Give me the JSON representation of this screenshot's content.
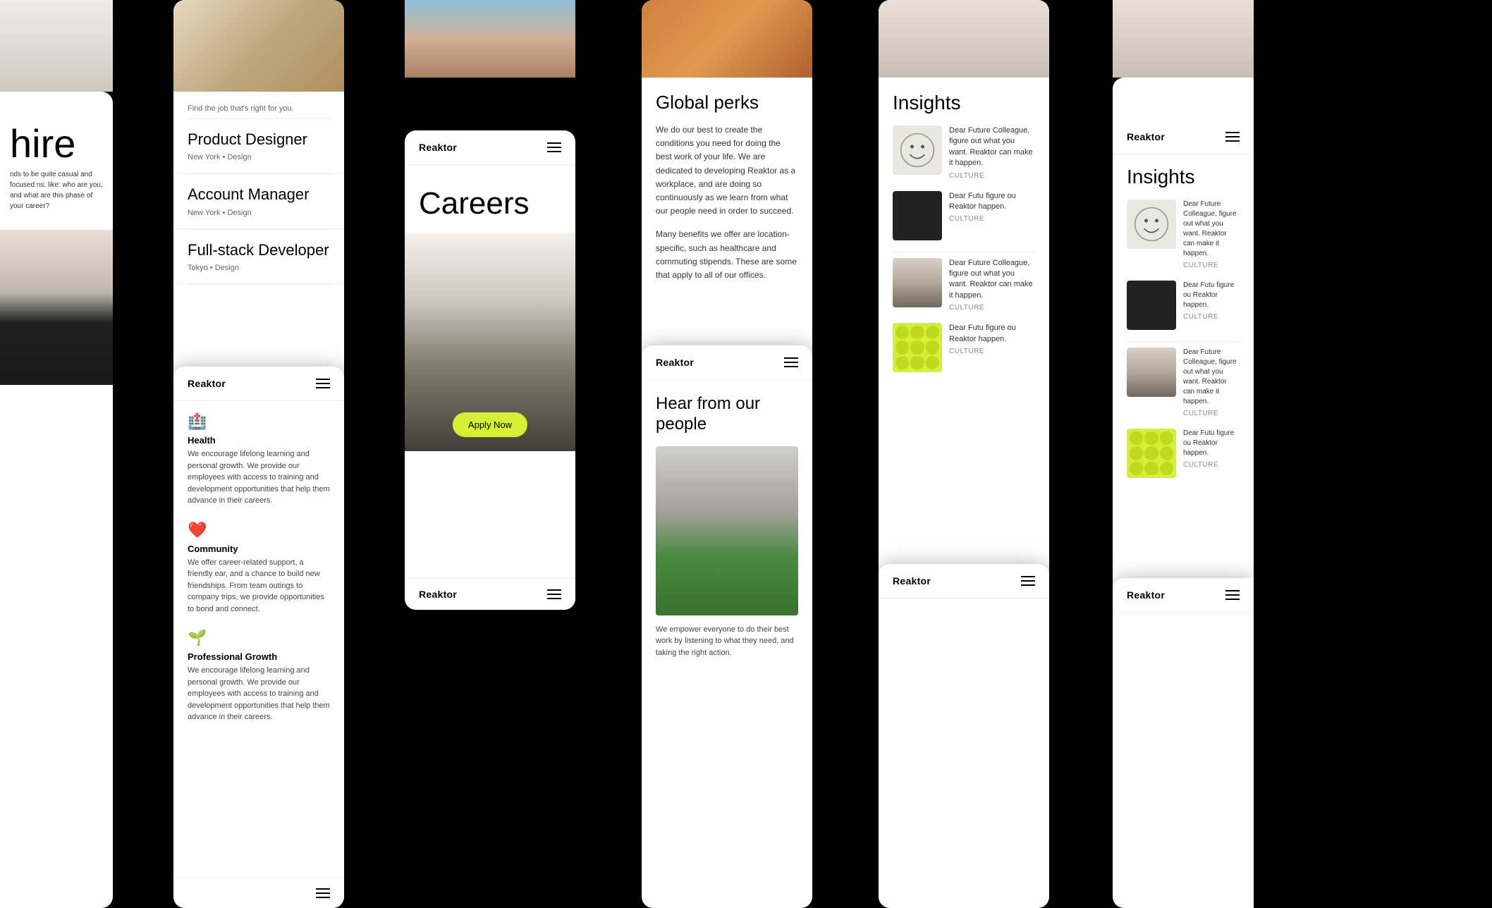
{
  "brand": {
    "logo": "Reaktor"
  },
  "cards": {
    "hire": {
      "heading": "hire",
      "subtext": "nds to be quite casual and focused ns, like: who are you, and what are this phase of your career?"
    },
    "jobs": {
      "subtitle": "Find the job that's right for you.",
      "list": [
        {
          "title": "Product Designer",
          "location": "New York",
          "department": "Design"
        },
        {
          "title": "Account Manager",
          "location": "New York",
          "department": "Design"
        },
        {
          "title": "Full-stack Developer",
          "location": "Tokyo",
          "department": "Design"
        }
      ]
    },
    "careers": {
      "title": "Careers",
      "apply_button": "Apply Now"
    },
    "perks": {
      "title": "Global perks",
      "text1": "We do our best to create the conditions you need for doing the best work of your life. We are dedicated to developing Reaktor as a workplace, and are doing so continuously as we learn from what our people need in order to succeed.",
      "text2": "Many benefits we offer are location-specific, such as healthcare and commuting stipends. These are some that apply to all of our offices."
    },
    "health": {
      "benefits": [
        {
          "icon": "🏥",
          "title": "Health",
          "desc": "We encourage lifelong learning and personal growth. We provide our employees with access to training and development opportunities that help them advance in their careers."
        },
        {
          "icon": "❤️",
          "title": "Community",
          "desc": "We offer career-related support, a friendly ear, and a chance to build new friendships. From team outings to company trips, we provide opportunities to bond and connect."
        },
        {
          "icon": "🌱",
          "title": "Professional Growth",
          "desc": "We encourage lifelong learning and personal growth. We provide our employees with access to training and development opportunities that help them advance in their careers."
        }
      ]
    },
    "people": {
      "title": "Hear from our people",
      "caption": "We empower everyone to do their best work by listening to what they need, and taking the right action."
    },
    "insights": {
      "title": "Insights",
      "items": [
        {
          "desc": "Dear Future Colleague, figure out what you want. Reaktor can make it happen.",
          "tag": "CULTURE"
        },
        {
          "desc": "Dear Futu figure ou Reaktor happen.",
          "tag": "CULTURE"
        },
        {
          "desc": "Dear Future Colleague, figure out what you want. Reaktor can make it happen.",
          "tag": "CULTURE"
        },
        {
          "desc": "Dear Futu figure ou Reaktor happen.",
          "tag": "CULTURE"
        }
      ]
    }
  },
  "icons": {
    "hamburger": "≡"
  }
}
